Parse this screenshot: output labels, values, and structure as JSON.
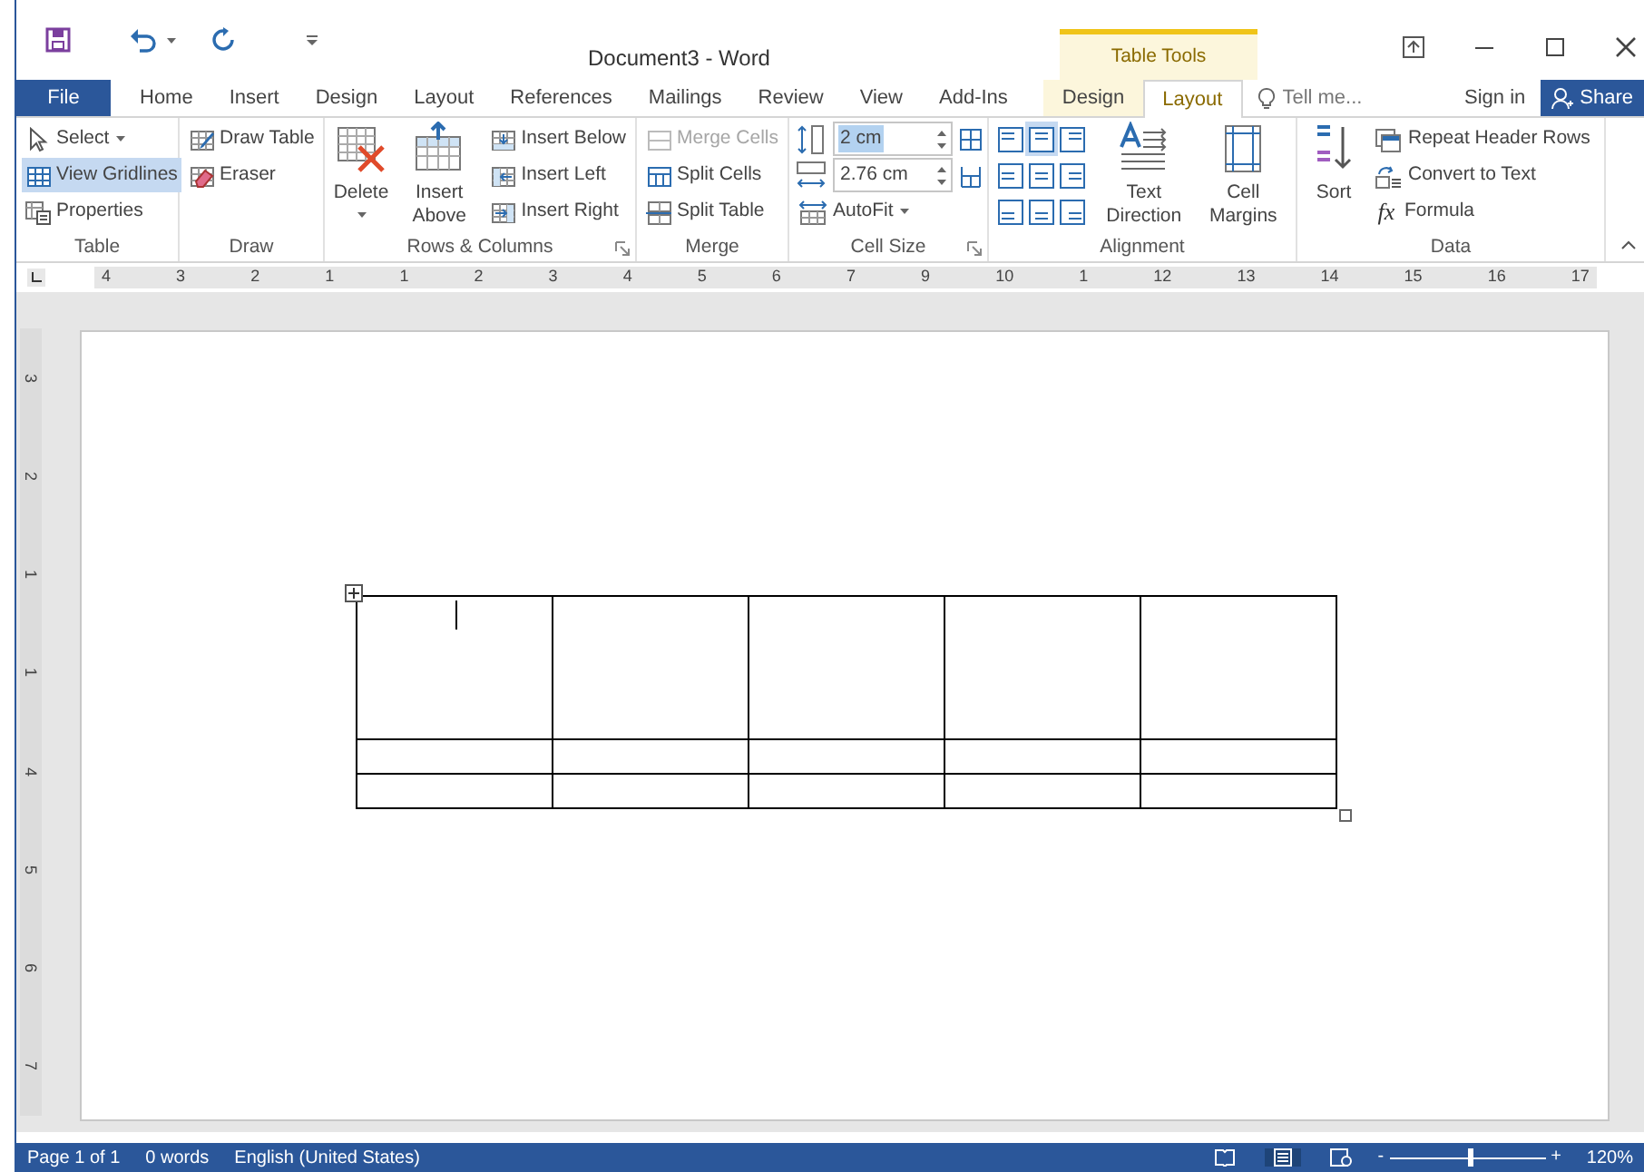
{
  "window": {
    "title": "Document3 - Word",
    "context_label": "Table Tools"
  },
  "tabs": [
    {
      "label": "File",
      "kind": "file",
      "selected": false
    },
    {
      "label": "Home",
      "kind": "normal",
      "selected": false
    },
    {
      "label": "Insert",
      "kind": "normal",
      "selected": false
    },
    {
      "label": "Design",
      "kind": "normal",
      "selected": false
    },
    {
      "label": "Layout",
      "kind": "normal",
      "selected": false
    },
    {
      "label": "References",
      "kind": "normal",
      "selected": false
    },
    {
      "label": "Mailings",
      "kind": "normal",
      "selected": false
    },
    {
      "label": "Review",
      "kind": "normal",
      "selected": false
    },
    {
      "label": "View",
      "kind": "normal",
      "selected": false
    },
    {
      "label": "Add-Ins",
      "kind": "normal",
      "selected": false
    },
    {
      "label": "Design",
      "kind": "context",
      "selected": false
    },
    {
      "label": "Layout",
      "kind": "context",
      "selected": true
    }
  ],
  "tell_me": {
    "placeholder": "Tell me..."
  },
  "sign_in": "Sign in",
  "share": "Share",
  "ribbon_groups": [
    {
      "label": "Table",
      "launcher": false,
      "items": [
        {
          "kind": "small",
          "label": "Select",
          "dropdown": true,
          "on": false
        },
        {
          "kind": "small",
          "label": "View Gridlines",
          "on": true
        },
        {
          "kind": "small",
          "label": "Properties",
          "on": false
        }
      ]
    },
    {
      "label": "Draw",
      "launcher": false,
      "items": [
        {
          "kind": "small",
          "label": "Draw Table"
        },
        {
          "kind": "small",
          "label": "Eraser"
        }
      ]
    },
    {
      "label": "Rows & Columns",
      "launcher": true,
      "items": [
        {
          "kind": "large",
          "label": "Delete",
          "dropdown": true
        },
        {
          "kind": "large",
          "label": "Insert Above"
        },
        {
          "kind": "small",
          "label": "Insert Below"
        },
        {
          "kind": "small",
          "label": "Insert Left"
        },
        {
          "kind": "small",
          "label": "Insert Right"
        }
      ]
    },
    {
      "label": "Merge",
      "launcher": false,
      "items": [
        {
          "kind": "small",
          "label": "Merge Cells",
          "disabled": true
        },
        {
          "kind": "small",
          "label": "Split Cells",
          "disabled": false
        },
        {
          "kind": "small",
          "label": "Split Table",
          "disabled": false
        }
      ]
    },
    {
      "label": "Cell Size",
      "launcher": true,
      "items": [
        {
          "kind": "field",
          "value": "2 cm",
          "highlighted": true
        },
        {
          "kind": "field",
          "value": "2.76 cm",
          "highlighted": false
        },
        {
          "kind": "small",
          "label": "AutoFit",
          "dropdown": true
        }
      ]
    },
    {
      "label": "Alignment",
      "launcher": false,
      "items": [
        {
          "kind": "align_grid",
          "cells": [
            {
              "selected": false
            },
            {
              "selected": true
            },
            {
              "selected": false
            },
            {
              "selected": false
            },
            {
              "selected": false
            },
            {
              "selected": false
            },
            {
              "selected": false
            },
            {
              "selected": false
            },
            {
              "selected": false
            }
          ]
        },
        {
          "kind": "large",
          "label": "Text Direction"
        },
        {
          "kind": "large",
          "label": "Cell Margins"
        }
      ]
    },
    {
      "label": "Data",
      "launcher": false,
      "items": [
        {
          "kind": "large",
          "label": "Sort"
        },
        {
          "kind": "small",
          "label": "Repeat Header Rows"
        },
        {
          "kind": "small",
          "label": "Convert to Text"
        },
        {
          "kind": "small",
          "label": "Formula",
          "glyph": "fx"
        }
      ]
    }
  ],
  "ruler": {
    "labels": [
      "4",
      "3",
      "2",
      "1",
      "1",
      "2",
      "3",
      "4",
      "5",
      "6",
      "7",
      "9",
      "10",
      "1",
      "12",
      "13",
      "14",
      "15",
      "16",
      "17"
    ]
  },
  "vertical_ruler": {
    "labels": [
      "3",
      "2",
      "1",
      "1",
      "4",
      "5",
      "6",
      "7"
    ]
  },
  "table": {
    "rows": [
      {
        "kind": "tall",
        "cells": [
          {
            "cursor": true
          },
          {
            "cursor": false
          },
          {
            "cursor": false
          },
          {
            "cursor": false
          },
          {
            "cursor": false
          }
        ]
      },
      {
        "kind": "short",
        "cells": [
          {
            "cursor": false
          },
          {
            "cursor": false
          },
          {
            "cursor": false
          },
          {
            "cursor": false
          },
          {
            "cursor": false
          }
        ]
      },
      {
        "kind": "short",
        "cells": [
          {
            "cursor": false
          },
          {
            "cursor": false
          },
          {
            "cursor": false
          },
          {
            "cursor": false
          },
          {
            "cursor": false
          }
        ]
      }
    ]
  },
  "status_bar": {
    "page": "Page 1 of 1",
    "words": "0 words",
    "language": "English (United States)",
    "zoom": {
      "out": "-",
      "in": "+",
      "level": 0.52,
      "reading": "120%"
    }
  }
}
